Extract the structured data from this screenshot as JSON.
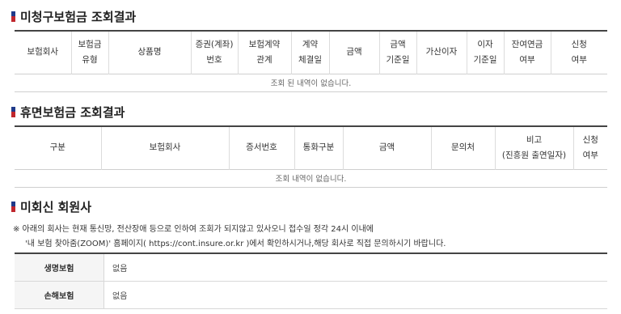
{
  "colors": {
    "flag_top": "#1f3a8a",
    "flag_bottom": "#c0262d",
    "header_border": "#444444"
  },
  "unclaimed": {
    "title": "미청구보험금 조회결과",
    "headers": [
      [
        "보험회사"
      ],
      [
        "보험금",
        "유형"
      ],
      [
        "상품명"
      ],
      [
        "증권(계좌)",
        "번호"
      ],
      [
        "보험계약",
        "관계"
      ],
      [
        "계약",
        "체결일"
      ],
      [
        "금액"
      ],
      [
        "금액",
        "기준일"
      ],
      [
        "가산이자"
      ],
      [
        "이자",
        "기준일"
      ],
      [
        "잔여연금",
        "여부"
      ],
      [
        "신청",
        "여부"
      ]
    ],
    "empty_message": "조회 된 내역이 없습니다."
  },
  "dormant": {
    "title": "휴면보험금 조회결과",
    "headers": [
      [
        "구분"
      ],
      [
        "보험회사"
      ],
      [
        "증서번호"
      ],
      [
        "통화구분"
      ],
      [
        "금액"
      ],
      [
        "문의처"
      ],
      [
        "비고",
        "(진흥원 출연일자)"
      ],
      [
        "신청",
        "여부"
      ]
    ],
    "empty_message": "조회 내역이 없습니다."
  },
  "members": {
    "title": "미회신 회원사",
    "notice_line1": "※ 아래의 회사는 현재 통신망, 전산장애 등으로 인하여 조회가 되지않고 있사오니 접수일 정각 24시 이내에",
    "notice_line2": "'내 보험 찾아줌(ZOOM)' 홈페이지( https://cont.insure.or.kr )에서 확인하시거나,해당 회사로 직접 문의하시기 바랍니다.",
    "rows": [
      {
        "label": "생명보험",
        "value": "없음"
      },
      {
        "label": "손해보험",
        "value": "없음"
      }
    ]
  }
}
